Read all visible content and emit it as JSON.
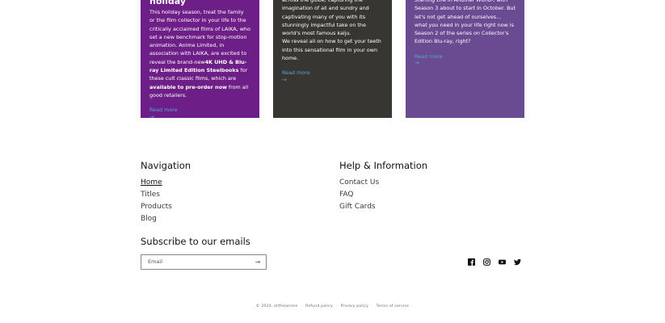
{
  "cards": [
    {
      "title": "holiday",
      "paragraphs": [
        [
          {
            "t": "This holiday season, treat the family or the film collector in your life to the critically acclaimed films of LAIKA, who set a new benchmark for stop-motion animation. Anime Limited, in association with LAIKA, are excited to reveal the brand-new"
          },
          {
            "t": "4K UHD & Blu-ray Limited Edition Steelbooks",
            "b": true
          },
          {
            "t": " for these cult classic films, which are "
          },
          {
            "t": "available to pre-order now",
            "b": true
          },
          {
            "t": " from all good retailers."
          }
        ]
      ],
      "read_more": "Read more"
    },
    {
      "title": "",
      "paragraphs": [
        [
          {
            "t": "across the globe, capturing the imagination of all and sundry and captivating many of you with its stunningly impactful take on the world's most famous kaiju."
          }
        ],
        [
          {
            "t": "We reveal all on how to get your teeth into this sensational film in your own home."
          }
        ]
      ],
      "read_more": "Read more"
    },
    {
      "title": "",
      "paragraphs": [
        [
          {
            "t": "Starting Life in Another World",
            "i": true
          },
          {
            "t": "-, with Season 3 about to start in October. But let's not get ahead of ourselves… what "
          },
          {
            "t": "you",
            "i": true
          },
          {
            "t": " need in your life right now is Season 2 of the series on Collector's Edition Blu-ray, right?"
          }
        ]
      ],
      "read_more": "Read more"
    }
  ],
  "navigation": {
    "heading": "Navigation",
    "items": [
      "Home",
      "Titles",
      "Products",
      "Blog"
    ],
    "active": "Home"
  },
  "help": {
    "heading": "Help & Information",
    "items": [
      "Contact Us",
      "FAQ",
      "Gift Cards"
    ]
  },
  "subscribe": {
    "heading": "Subscribe to our emails",
    "placeholder": "Email",
    "submit_icon": "arrow-right-icon"
  },
  "social": [
    "facebook-icon",
    "instagram-icon",
    "youtube-icon",
    "twitter-icon"
  ],
  "legal": {
    "copyright": "© 2024, alltheanime",
    "links": [
      "Refund policy",
      "Privacy policy",
      "Terms of service"
    ]
  },
  "colors": {
    "card1": "#6d1f87",
    "card2": "#383632",
    "card3": "#6a4a91",
    "link": "#5aa4d8"
  }
}
